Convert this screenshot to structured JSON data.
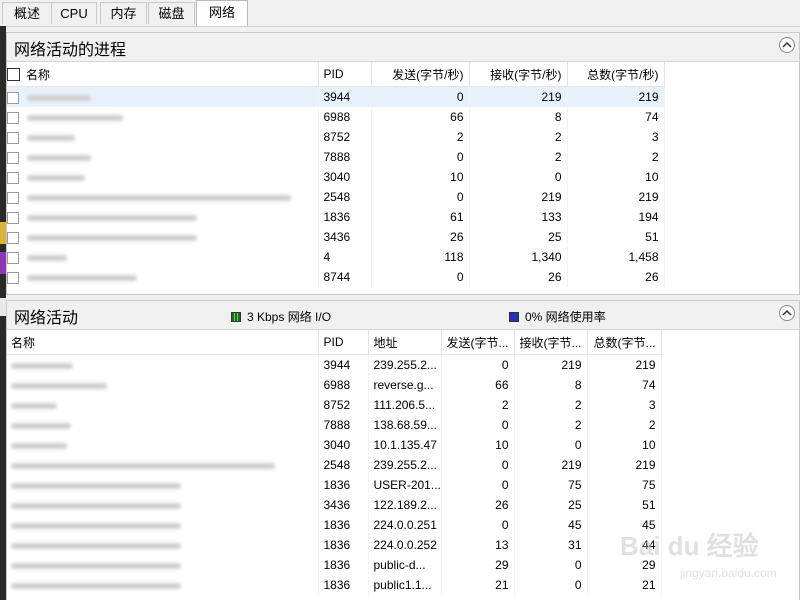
{
  "tabs": [
    {
      "label": "概述",
      "active": false
    },
    {
      "label": "CPU",
      "active": false
    },
    {
      "label": "内存",
      "active": false
    },
    {
      "label": "磁盘",
      "active": false
    },
    {
      "label": "网络",
      "active": true
    }
  ],
  "processes_section": {
    "title": "网络活动的进程",
    "columns": [
      "名称",
      "PID",
      "发送(字节/秒)",
      "接收(字节/秒)",
      "总数(字节/秒)"
    ],
    "rows": [
      {
        "pid": "3944",
        "send": "0",
        "recv": "219",
        "total": "219",
        "selected": true
      },
      {
        "pid": "6988",
        "send": "66",
        "recv": "8",
        "total": "74"
      },
      {
        "pid": "8752",
        "send": "2",
        "recv": "2",
        "total": "3"
      },
      {
        "pid": "7888",
        "send": "0",
        "recv": "2",
        "total": "2"
      },
      {
        "pid": "3040",
        "send": "10",
        "recv": "0",
        "total": "10"
      },
      {
        "pid": "2548",
        "send": "0",
        "recv": "219",
        "total": "219"
      },
      {
        "pid": "1836",
        "send": "61",
        "recv": "133",
        "total": "194"
      },
      {
        "pid": "3436",
        "send": "26",
        "recv": "25",
        "total": "51"
      },
      {
        "pid": "4",
        "send": "118",
        "recv": "1,340",
        "total": "1,458"
      },
      {
        "pid": "8744",
        "send": "0",
        "recv": "26",
        "total": "26"
      }
    ]
  },
  "network_section": {
    "title": "网络活动",
    "io_indicator": "3 Kbps 网络 I/O",
    "usage_indicator": "0% 网络使用率",
    "columns": [
      "名称",
      "PID",
      "地址",
      "发送(字节...",
      "接收(字节...",
      "总数(字节..."
    ],
    "rows": [
      {
        "pid": "3944",
        "addr": "239.255.2...",
        "send": "0",
        "recv": "219",
        "total": "219"
      },
      {
        "pid": "6988",
        "addr": "reverse.g...",
        "send": "66",
        "recv": "8",
        "total": "74"
      },
      {
        "pid": "8752",
        "addr": "111.206.5...",
        "send": "2",
        "recv": "2",
        "total": "3"
      },
      {
        "pid": "7888",
        "addr": "138.68.59...",
        "send": "0",
        "recv": "2",
        "total": "2"
      },
      {
        "pid": "3040",
        "addr": "10.1.135.47",
        "send": "10",
        "recv": "0",
        "total": "10"
      },
      {
        "pid": "2548",
        "addr": "239.255.2...",
        "send": "0",
        "recv": "219",
        "total": "219"
      },
      {
        "pid": "1836",
        "addr": "USER-201...",
        "send": "0",
        "recv": "75",
        "total": "75"
      },
      {
        "pid": "3436",
        "addr": "122.189.2...",
        "send": "26",
        "recv": "25",
        "total": "51"
      },
      {
        "pid": "1836",
        "addr": "224.0.0.251",
        "send": "0",
        "recv": "45",
        "total": "45"
      },
      {
        "pid": "1836",
        "addr": "224.0.0.252",
        "send": "13",
        "recv": "31",
        "total": "44"
      },
      {
        "pid": "1836",
        "addr": "public-d...",
        "send": "29",
        "recv": "0",
        "total": "29"
      },
      {
        "pid": "1836",
        "addr": "public1.1...",
        "send": "21",
        "recv": "0",
        "total": "21"
      }
    ]
  },
  "watermark": {
    "text": "Bai du 经验",
    "sub": "jingyan.baidu.com"
  },
  "colors": {
    "selected_row": "#e8f1fb",
    "io_indicator": "#2e9a2e",
    "usage_indicator": "#2331b8"
  }
}
